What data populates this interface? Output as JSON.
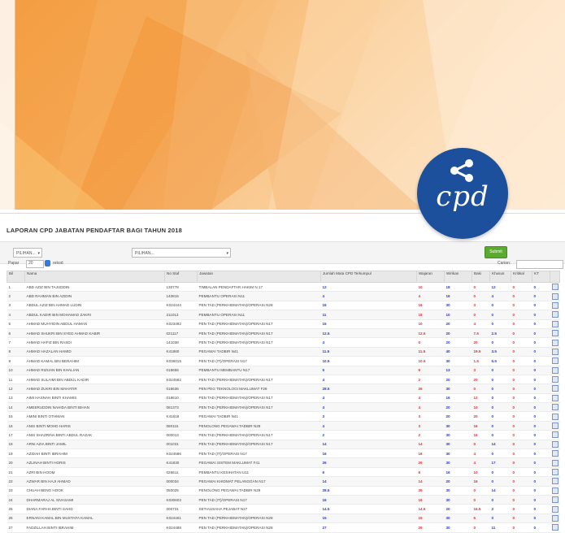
{
  "brand": {
    "logo_text": "cpd",
    "accent": "#1c4f9c"
  },
  "report": {
    "title": "LAPORAN CPD JABATAN PENDAFTAR BAGI TAHUN 2018",
    "filters": {
      "select1": "PILIHAN...",
      "select2": "PILIHAN...",
      "submit_label": "Submit"
    },
    "tools": {
      "show_label": "Papar",
      "entries_value": "20",
      "entries_suffix": "rekod",
      "search_label": "Carian:"
    },
    "columns": [
      "Bil",
      "Nama",
      "No Staf",
      "Jawatan",
      "Jumlah Mata CPD Terkumpul",
      "Wajaran",
      "Wirikan",
      "Baki",
      "Khusus",
      "Kritikal",
      "KT",
      ""
    ],
    "rows": [
      {
        "no": "1",
        "name": "ABD AZIZ BIN TAJUDDIN",
        "staff": "130778",
        "post": "TIMBALAN PENDAFTAR HAKIM N 17",
        "total": "12",
        "w": "10",
        "wr": "18",
        "b": "0",
        "k": "12",
        "kr": "0",
        "kt": "0"
      },
      {
        "no": "2",
        "name": "ABD RAHMAN BIN AZIDIN",
        "staff": "140815",
        "post": "PEMBANTU OPERASI N11",
        "total": "4",
        "w": "4",
        "wr": "16",
        "b": "0",
        "k": "4",
        "kr": "0",
        "kt": "0"
      },
      {
        "no": "3",
        "name": "ABDUL AZIZ BIN AHMAD LUDIN",
        "staff": "K024444",
        "post": "PEN TAD (PERKHIDMATAN)/OPERASI N28",
        "total": "16",
        "w": "16",
        "wr": "30",
        "b": "3",
        "k": "0",
        "kr": "0",
        "kt": "0"
      },
      {
        "no": "4",
        "name": "ABDUL KADIR BIN MOHAMAD ZAKRI",
        "staff": "211013",
        "post": "PEMBANTU OPERASI N11",
        "total": "11",
        "w": "18",
        "wr": "10",
        "b": "0",
        "k": "0",
        "kr": "0",
        "kt": "0"
      },
      {
        "no": "5",
        "name": "AHMAD MUHYIDIN ABDUL HAMAN",
        "staff": "K023492",
        "post": "PEN TAD (PERKHIDMATAN)/OPERASI N17",
        "total": "15",
        "w": "10",
        "wr": "20",
        "b": "4",
        "k": "0",
        "kr": "0",
        "kt": "0"
      },
      {
        "no": "6",
        "name": "AHMAD SHUKRI BIN SYED AHMAD KABIR",
        "staff": "021117",
        "post": "PEN TAD (PERKHIDMATAN)/OPERASI N17",
        "total": "12.5",
        "w": "12.5",
        "wr": "20",
        "b": "7.5",
        "k": "2.5",
        "kr": "0",
        "kt": "0"
      },
      {
        "no": "7",
        "name": "AHMAD HAFIZ BIN RASDI",
        "staff": "141038",
        "post": "PEN TAD (PERKHIDMATAN)/OPERASI N17",
        "total": "4",
        "w": "0",
        "wr": "20",
        "b": "20",
        "k": "0",
        "kr": "0",
        "kt": "0"
      },
      {
        "no": "8",
        "name": "AHMAD HAZALAN HAMID",
        "staff": "K41860",
        "post": "PEGAWAI TADBIR N41",
        "total": "11.5",
        "w": "11.5",
        "wr": "40",
        "b": "19.5",
        "k": "3.5",
        "kr": "0",
        "kt": "0"
      },
      {
        "no": "9",
        "name": "AHMAD KAMAL BIN BERAHIM",
        "staff": "K036015",
        "post": "PEN TAD (IT)/OPERASI N17",
        "total": "10.5",
        "w": "10.5",
        "wr": "30",
        "b": "1.5",
        "k": "5.5",
        "kr": "0",
        "kt": "0"
      },
      {
        "no": "10",
        "name": "AHMAD RIZUAN BIN KHALIAN",
        "staff": "018655",
        "post": "PEMBANTU MEMBANTU N17",
        "total": "5",
        "w": "6",
        "wr": "13",
        "b": "3",
        "k": "0",
        "kr": "0",
        "kt": "0"
      },
      {
        "no": "11",
        "name": "AHMAD SULAIMI BIN ABDUL KADIR",
        "staff": "K024582",
        "post": "PEN TAD (PERKHIDMATAN)/OPERASI N17",
        "total": "4",
        "w": "2",
        "wr": "20",
        "b": "20",
        "k": "0",
        "kr": "0",
        "kt": "0"
      },
      {
        "no": "12",
        "name": "AHMAD ZUKRI BIN MAHATIR",
        "staff": "018636",
        "post": "PEN PEG TEKNOLOGI MAKLUMAT F29",
        "total": "28.5",
        "w": "26",
        "wr": "30",
        "b": "0",
        "k": "0",
        "kr": "0",
        "kt": "0"
      },
      {
        "no": "13",
        "name": "AIMI HASNAH BINTI KHAMIS",
        "staff": "018610",
        "post": "PEN TAD (PERKHIDMATAN)/OPERASI N17",
        "total": "4",
        "w": "4",
        "wr": "16",
        "b": "12",
        "k": "0",
        "kr": "0",
        "kt": "0"
      },
      {
        "no": "14",
        "name": "AMEERUDDIN NAHIDA BINTI BIHAN",
        "staff": "081373",
        "post": "PEN TAD (PERKHIDMATAN)/OPERASI N17",
        "total": "4",
        "w": "4",
        "wr": "20",
        "b": "10",
        "k": "0",
        "kr": "0",
        "kt": "0"
      },
      {
        "no": "15",
        "name": "AMINI BINTI OTHMAN",
        "staff": "K41616",
        "post": "PEGAWAI TADBIR N41",
        "total": "3",
        "w": "3",
        "wr": "20",
        "b": "20",
        "k": "0",
        "kr": "0",
        "kt": "0"
      },
      {
        "no": "16",
        "name": "ANIS BINTI MOHD HARIS",
        "staff": "080115",
        "post": "PENOLONG PEGAWAI TADBIR N29",
        "total": "4",
        "w": "3",
        "wr": "30",
        "b": "16",
        "k": "0",
        "kr": "0",
        "kt": "0"
      },
      {
        "no": "17",
        "name": "ANIS SHAZRINA BINTI ABDUL RAZAK",
        "staff": "000013",
        "post": "PEN TAD (PERKHIDMATAN)/OPERASI N17",
        "total": "2",
        "w": "2",
        "wr": "30",
        "b": "16",
        "k": "0",
        "kr": "0",
        "kt": "0"
      },
      {
        "no": "18",
        "name": "ARNI AZIA BINTI JAMIL",
        "staff": "001031",
        "post": "PEN TAD (PERKHIDMATAN)/OPERASI N17",
        "total": "14",
        "w": "14",
        "wr": "30",
        "b": "0",
        "k": "14",
        "kr": "0",
        "kt": "0"
      },
      {
        "no": "19",
        "name": "AZIDAH BINTI IBRAHIM",
        "staff": "K024586",
        "post": "PEN TAD (IT)/OPERASI N17",
        "total": "16",
        "w": "16",
        "wr": "30",
        "b": "4",
        "k": "0",
        "kr": "0",
        "kt": "0"
      },
      {
        "no": "20",
        "name": "AZLINAH BINTI HORIS",
        "staff": "K41830",
        "post": "PEGAWAI SISTEM MAKLUMAT F41",
        "total": "26",
        "w": "26",
        "wr": "30",
        "b": "4",
        "k": "17",
        "kr": "0",
        "kt": "0"
      },
      {
        "no": "21",
        "name": "AZRI BIN HOOM",
        "staff": "026611",
        "post": "PEMBANTU KESIHATAN U11",
        "total": "6",
        "w": "6",
        "wr": "16",
        "b": "10",
        "k": "0",
        "kr": "0",
        "kt": "0"
      },
      {
        "no": "22",
        "name": "AZWAR BIN HAJI AHMAD",
        "staff": "000034",
        "post": "PEGAWAI KHIDMAT PELANGGAN N17",
        "total": "14",
        "w": "14",
        "wr": "20",
        "b": "16",
        "k": "0",
        "kr": "0",
        "kt": "0"
      },
      {
        "no": "23",
        "name": "CHUAH BENG HOOK",
        "staff": "050025",
        "post": "PENOLONG PEGAWAI TADBIR N29",
        "total": "28.5",
        "w": "26",
        "wr": "30",
        "b": "0",
        "k": "14",
        "kr": "0",
        "kt": "0"
      },
      {
        "no": "24",
        "name": "DHARMARAJ AL SIVASAMI",
        "staff": "K030603",
        "post": "PEN TAD (IT)/OPERASI N17",
        "total": "16",
        "w": "16",
        "wr": "30",
        "b": "0",
        "k": "0",
        "kr": "0",
        "kt": "0"
      },
      {
        "no": "25",
        "name": "DIANA FARHA BINTI SAHD",
        "staff": "000731",
        "post": "SETIAUSAHA PEJABAT N27",
        "total": "14.5",
        "w": "14.5",
        "wr": "20",
        "b": "16.5",
        "k": "2",
        "kr": "0",
        "kt": "0"
      },
      {
        "no": "26",
        "name": "ERNANI KAMAL BIN MUSTAFA KAMAL",
        "staff": "K024461",
        "post": "PEN TAD (PERKHIDMATAN)/OPERASI N28",
        "total": "15",
        "w": "15",
        "wr": "30",
        "b": "5",
        "k": "0",
        "kr": "0",
        "kt": "0"
      },
      {
        "no": "27",
        "name": "FADZILLAH BINTI IBRAHIM",
        "staff": "K024488",
        "post": "PEN TAD (PERKHIDMATAN)/OPERASI N28",
        "total": "27",
        "w": "26",
        "wr": "30",
        "b": "0",
        "k": "11",
        "kr": "0",
        "kt": "0"
      }
    ]
  }
}
